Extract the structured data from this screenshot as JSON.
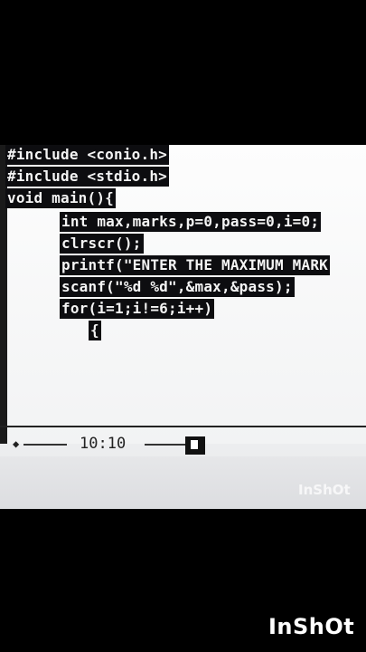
{
  "editor": {
    "lines": [
      "#include <conio.h>",
      "#include <stdio.h>",
      "void main(){",
      "int max,marks,p=0,pass=0,i=0;",
      "clrscr();",
      "printf(\"ENTER THE MAXIMUM MARK",
      "scanf(\"%d %d\",&max,&pass);",
      "for(i=1;i!=6;i++)",
      "{"
    ]
  },
  "status": {
    "cursor_position": "10:10"
  },
  "watermark": {
    "text_small": "InShOt",
    "text_large": "InShOt"
  }
}
